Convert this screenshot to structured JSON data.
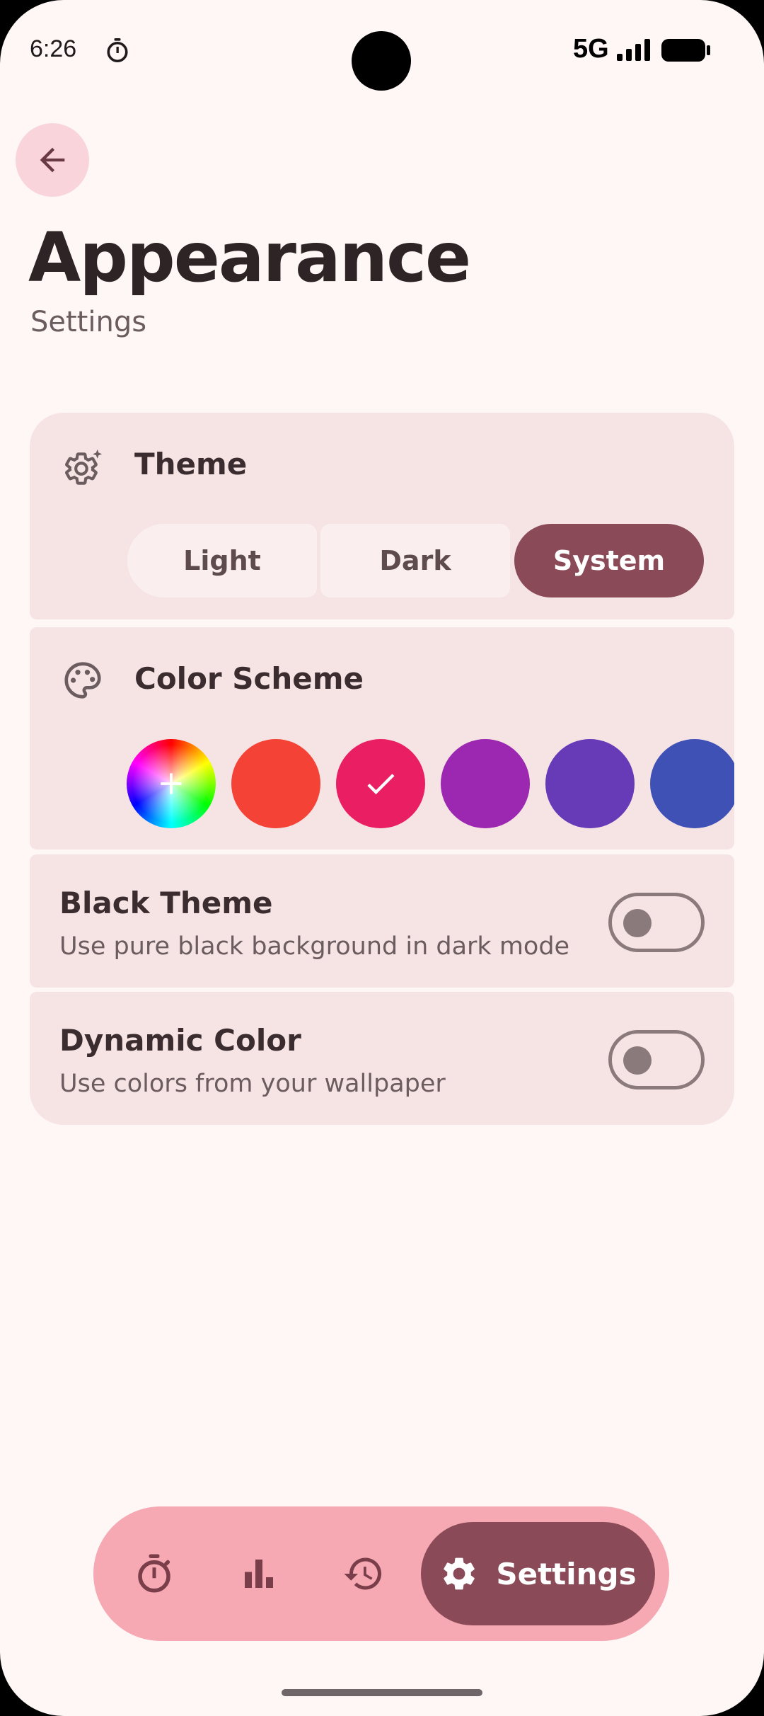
{
  "status_bar": {
    "time": "6:26",
    "network": "5G"
  },
  "header": {
    "title": "Appearance",
    "subtitle": "Settings"
  },
  "theme": {
    "title": "Theme",
    "options": [
      "Light",
      "Dark",
      "System"
    ],
    "selected": "System"
  },
  "color_scheme": {
    "title": "Color Scheme",
    "swatches": [
      "custom",
      "#F44336",
      "#E91E63",
      "#9C27B0",
      "#673AB7",
      "#3F51B5"
    ],
    "selected_index": 2
  },
  "black_theme": {
    "title": "Black Theme",
    "description": "Use pure black background in dark mode",
    "enabled": false
  },
  "dynamic_color": {
    "title": "Dynamic Color",
    "description": "Use colors from your wallpaper",
    "enabled": false
  },
  "bottom_nav": {
    "active_label": "Settings"
  },
  "colors": {
    "accent": "#8B4A57",
    "nav_bg": "#F6A9B3",
    "card_bg": "#F6E4E5",
    "page_bg": "#FFF7F6"
  }
}
